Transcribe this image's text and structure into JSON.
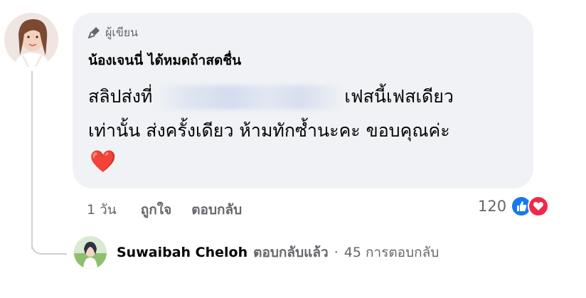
{
  "comment": {
    "author_badge": "ผู้เขียน",
    "author_name": "น้องเจนนี่ ได้หมดถ้าสดชื่น",
    "text_before_blur": "สลิปส่งที่",
    "text_after_blur": "เฟสนี้เฟสเดียว",
    "text_line2": "เท่านั้น ส่งครั้งเดียว ห้ามทักซ้ำนะคะ ขอบคุณค่ะ",
    "emoji": "❤️",
    "time": "1 วัน",
    "like_action": "ถูกใจ",
    "reply_action": "ตอบกลับ",
    "reaction_count": "120"
  },
  "reply_summary": {
    "replier_name": "Suwaibah Cheloh",
    "verb": "ตอบกลับแล้ว",
    "separator": "·",
    "count_text": "45 การตอบกลับ"
  },
  "icons": {
    "author": "microphone-icon",
    "like": "thumbs-up-icon",
    "love": "heart-icon"
  },
  "colors": {
    "bubble": "#f0f2f5",
    "like": "#1877f2",
    "love": "#f02849",
    "muted": "#65676b"
  }
}
